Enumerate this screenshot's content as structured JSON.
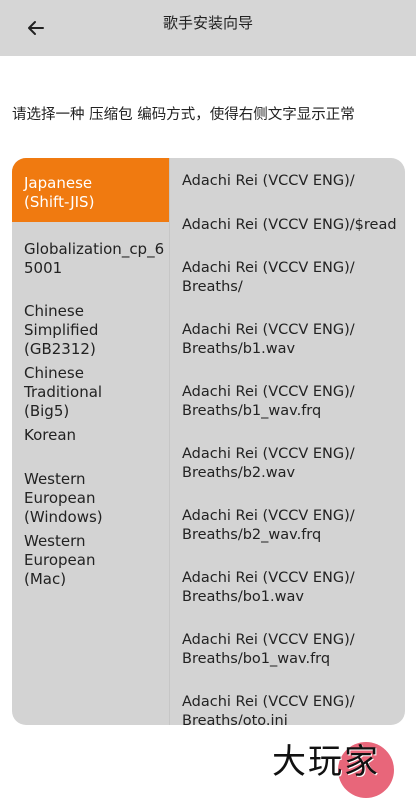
{
  "header": {
    "title": "歌手安装向导"
  },
  "prompt": "请选择一种 压缩包 编码方式，使得右侧文字显示正常",
  "encodings": [
    {
      "label": "Japanese\n(Shift-JIS)",
      "selected": true
    },
    {
      "label": "Globalization_cp_6\n5001"
    },
    {
      "label": "Chinese Simplified\n(GB2312)"
    },
    {
      "label": "Chinese Traditional\n(Big5)"
    },
    {
      "label": "Korean"
    },
    {
      "label": "Western European\n(Windows)"
    },
    {
      "label": "Western European\n(Mac)"
    }
  ],
  "files": [
    "Adachi Rei (VCCV ENG)/",
    "Adachi Rei (VCCV ENG)/$read",
    "Adachi Rei (VCCV ENG)/\nBreaths/",
    "Adachi Rei (VCCV ENG)/\nBreaths/b1.wav",
    "Adachi Rei (VCCV ENG)/\nBreaths/b1_wav.frq",
    "Adachi Rei (VCCV ENG)/\nBreaths/b2.wav",
    "Adachi Rei (VCCV ENG)/\nBreaths/b2_wav.frq",
    "Adachi Rei (VCCV ENG)/\nBreaths/bo1.wav",
    "Adachi Rei (VCCV ENG)/\nBreaths/bo1_wav.frq",
    "Adachi Rei (VCCV ENG)/\nBreaths/oto.ini"
  ],
  "watermark": "大玩家",
  "colors": {
    "accent": "#f07a10",
    "fab": "#e8667a"
  }
}
